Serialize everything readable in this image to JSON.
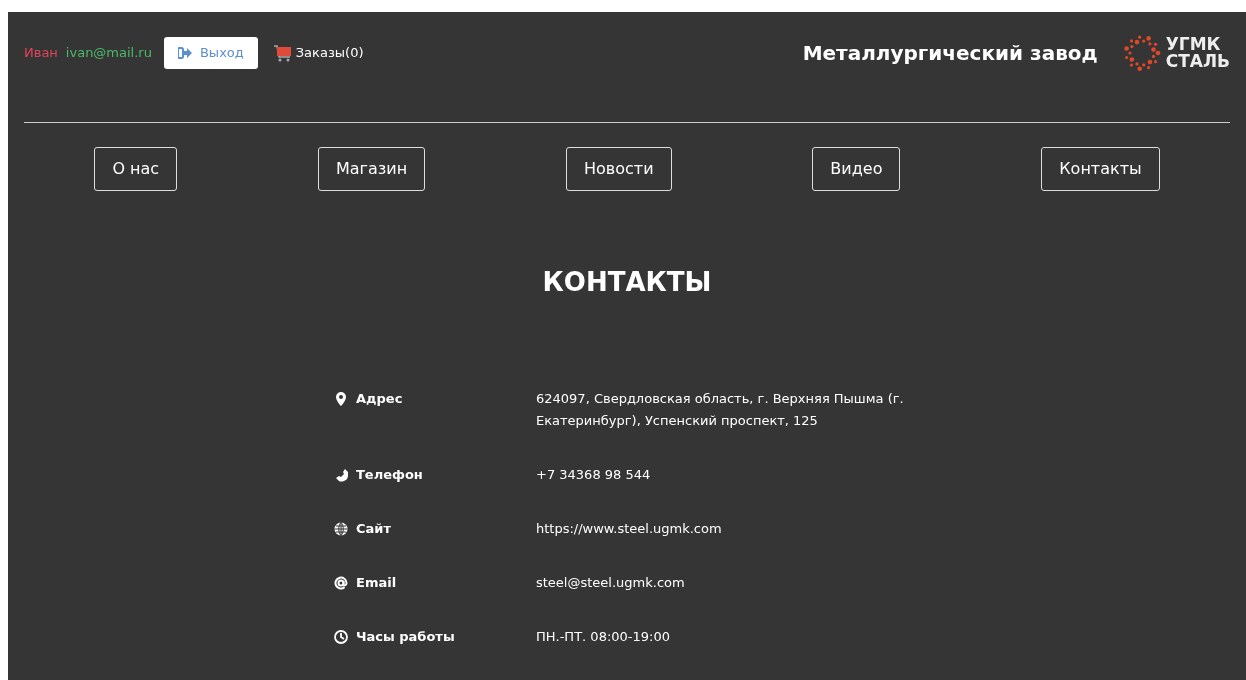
{
  "header": {
    "user_name": "Иван",
    "user_email": "ivan@mail.ru",
    "logout_button": "Выход",
    "orders_link": "Заказы(0)",
    "site_title": "Металлургический завод",
    "logo_lines": [
      "УГМК",
      "СТАЛЬ"
    ]
  },
  "nav": [
    "О нас",
    "Магазин",
    "Новости",
    "Видео",
    "Контакты"
  ],
  "page_title": "КОНТАКТЫ",
  "contacts": [
    {
      "kind": "address",
      "label": "Адрес",
      "value": "624097, Свердловская область, г. Верхняя Пышма (г. Екатеринбург), Успенский проспект, 125"
    },
    {
      "kind": "phone",
      "label": "Телефон",
      "value": "+7 34368 98 544"
    },
    {
      "kind": "site",
      "label": "Сайт",
      "value": "https://www.steel.ugmk.com"
    },
    {
      "kind": "email",
      "label": "Email",
      "value": "steel@steel.ugmk.com"
    },
    {
      "kind": "hours",
      "label": "Часы работы",
      "value": "ПН.-ПТ. 08:00-19:00"
    }
  ]
}
